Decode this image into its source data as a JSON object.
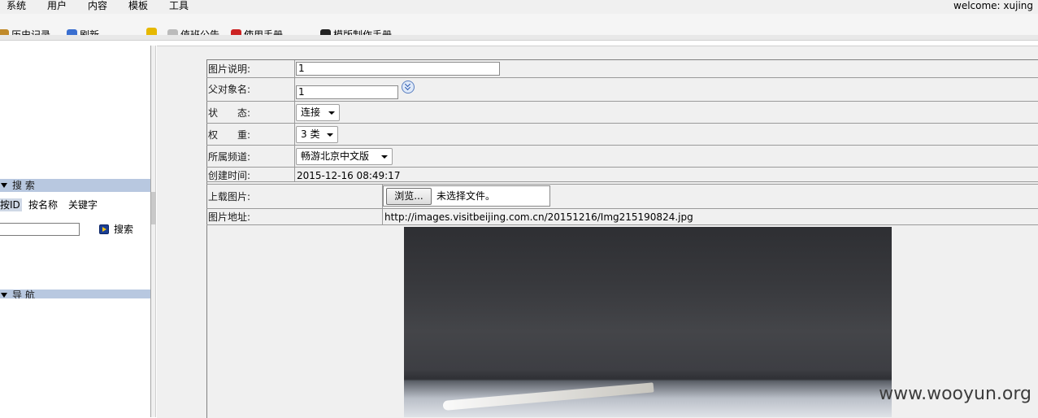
{
  "menu": [
    "系统",
    "用户",
    "内容",
    "模板",
    "工具"
  ],
  "welcome": "welcome: xujing",
  "toolbar": [
    {
      "label": "历史记录",
      "icon": "history-icon",
      "color": "#c08a2a"
    },
    {
      "label": "刷新",
      "icon": "refresh-icon",
      "color": "#3a6fd0"
    },
    {
      "label": "",
      "icon": "star-icon",
      "color": "#e6b800"
    },
    {
      "label": "值班公告",
      "icon": "notice-icon",
      "color": "#777777"
    },
    {
      "label": "使用手册",
      "icon": "manual-icon",
      "color": "#cc2222"
    },
    {
      "label": "模版制作手册",
      "icon": "template-manual-icon",
      "color": "#222222"
    }
  ],
  "sidebar": {
    "search_title": "搜 索",
    "search_tabs": [
      "按ID",
      "按名称",
      "关键字"
    ],
    "search_input": "",
    "search_button": "搜索",
    "nav_title": "导 航"
  },
  "form": {
    "caption_label": "图片说明:",
    "caption_value": "1",
    "parent_label": "父对象名:",
    "parent_value": "1",
    "status_label": "状　　态:",
    "status_value": "连接",
    "weight_label": "权　　重:",
    "weight_value": "3 类",
    "channel_label": "所属频道:",
    "channel_value": "畅游北京中文版",
    "created_label": "创建时间:",
    "created_value": "2015-12-16 08:49:17",
    "upload_label": "上载图片:",
    "browse_button": "浏览...",
    "no_file": "未选择文件。",
    "url_label": "图片地址:",
    "url_value": "http://images.visitbeijing.com.cn/20151216/Img215190824.jpg"
  },
  "watermark": "www.wooyun.org"
}
